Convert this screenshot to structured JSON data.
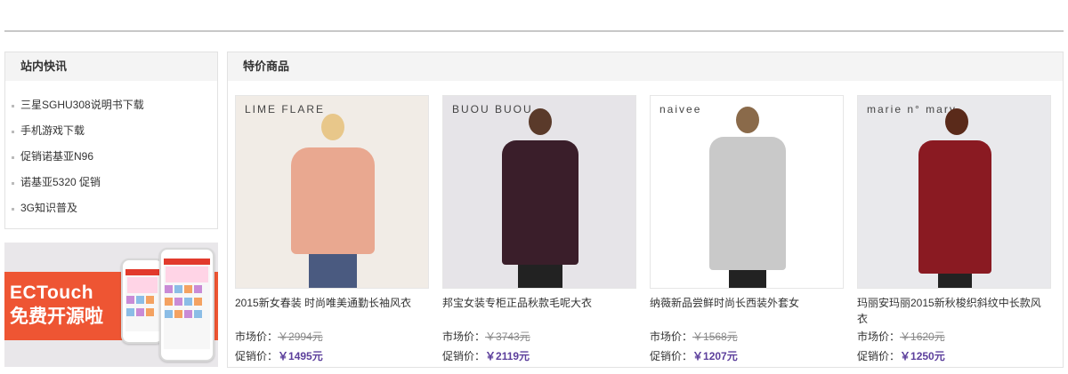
{
  "news": {
    "title": "站内快讯",
    "items": [
      "三星SGHU308说明书下载",
      "手机游戏下载",
      "促销诺基亚N96",
      "诺基亚5320 促销",
      "3G知识普及"
    ]
  },
  "promo_banner": {
    "title": "ECTouch",
    "subtitle": "免费开源啦"
  },
  "specials": {
    "title": "特价商品",
    "market_label": "市场价：",
    "promo_label": "促销价：",
    "products": [
      {
        "brand": "LIME FLARE",
        "name": "2015新女春装 时尚唯美通勤长袖风衣",
        "market_price": "￥2994元",
        "promo_price": "￥1495元",
        "bg": "#f1ece6",
        "garment": "#e9a890"
      },
      {
        "brand": "BUOU BUOU",
        "name": "邦宝女装专柜正品秋款毛呢大衣",
        "market_price": "￥3743元",
        "promo_price": "￥2119元",
        "bg": "#e6e4e8",
        "garment": "#3a1e2a"
      },
      {
        "brand": "naivee",
        "name": "纳薇新品尝鲜时尚长西装外套女",
        "market_price": "￥1568元",
        "promo_price": "￥1207元",
        "bg": "#ffffff",
        "garment": "#c9c9c9"
      },
      {
        "brand": "marie n° mary",
        "name": "玛丽安玛丽2015新秋梭织斜纹中长款风衣",
        "market_price": "￥1620元",
        "promo_price": "￥1250元",
        "bg": "#e9e9ec",
        "garment": "#8a1a22"
      }
    ]
  }
}
